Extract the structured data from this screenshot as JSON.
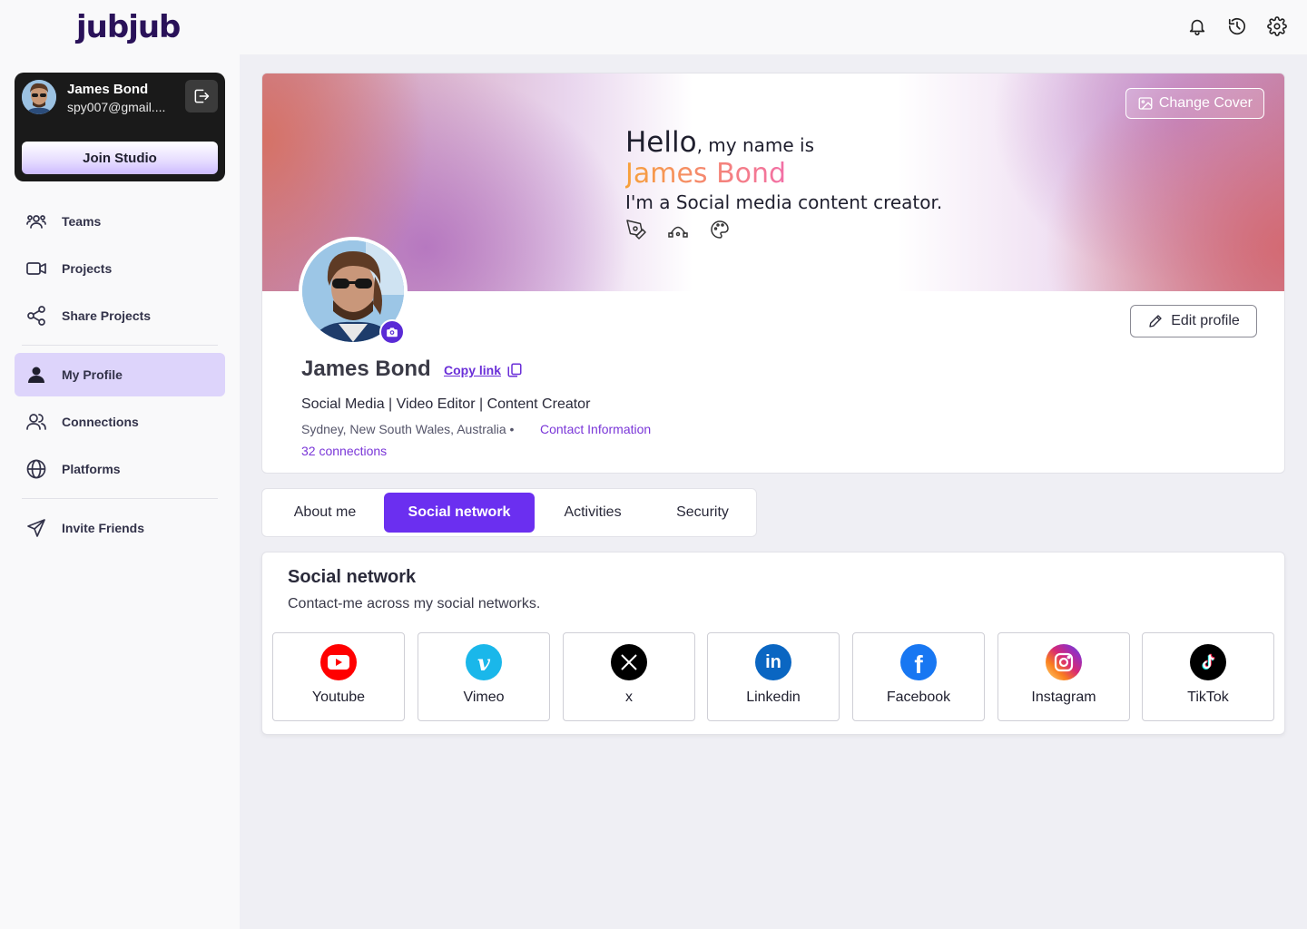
{
  "app": {
    "logo": "jubjub"
  },
  "topbar": {
    "icons": [
      "bell-icon",
      "history-icon",
      "settings-icon"
    ]
  },
  "user": {
    "name": "James Bond",
    "email": "spy007@gmail....",
    "join_label": "Join Studio"
  },
  "sidebar": {
    "items": [
      {
        "label": "Teams",
        "icon": "teams-icon"
      },
      {
        "label": "Projects",
        "icon": "video-camera-icon"
      },
      {
        "label": "Share Projects",
        "icon": "share-icon"
      },
      {
        "label": "My Profile",
        "icon": "person-icon",
        "active": true
      },
      {
        "label": "Connections",
        "icon": "users-icon"
      },
      {
        "label": "Platforms",
        "icon": "globe-icon"
      },
      {
        "label": "Invite Friends",
        "icon": "send-icon"
      }
    ]
  },
  "cover": {
    "change_label": "Change Cover",
    "hello": "Hello",
    "my_name_is": ", my name is",
    "name": "James Bond",
    "role": "I'm a Social media content creator."
  },
  "profile": {
    "name": "James Bond",
    "copy_link": "Copy link",
    "edit_label": "Edit profile",
    "headline": "Social Media | Video Editor | Content Creator",
    "location": "Sydney, New South Wales, Australia •",
    "contact": "Contact Information",
    "connections": "32 connections"
  },
  "tabs": [
    {
      "label": "About me"
    },
    {
      "label": "Social network",
      "active": true
    },
    {
      "label": "Activities"
    },
    {
      "label": "Security"
    }
  ],
  "social": {
    "title": "Social network",
    "subtitle": "Contact-me across my social networks.",
    "platforms": [
      {
        "label": "Youtube",
        "color": "#ff0000"
      },
      {
        "label": "Vimeo",
        "color": "#1ab7ea"
      },
      {
        "label": "x",
        "color": "#000000"
      },
      {
        "label": "Linkedin",
        "color": "#0a66c2"
      },
      {
        "label": "Facebook",
        "color": "#1877f2"
      },
      {
        "label": "Instagram",
        "color": "#e1306c"
      },
      {
        "label": "TikTok",
        "color": "#000000"
      }
    ]
  },
  "colors": {
    "accent": "#6b2ff0",
    "active_nav": "#ddd4fb",
    "link": "#7a36d8"
  }
}
